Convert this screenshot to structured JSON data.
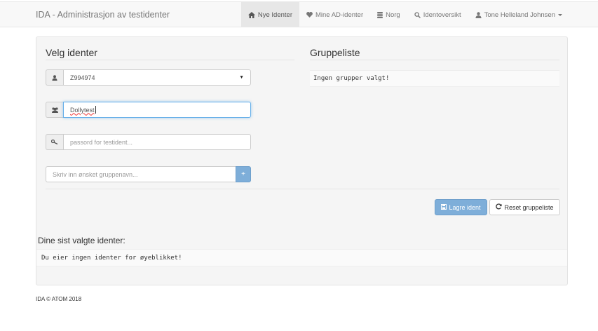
{
  "navbar": {
    "brand": "IDA - Administrasjon av testidenter",
    "items": [
      {
        "label": "Nye Identer",
        "icon": "home-icon",
        "active": true
      },
      {
        "label": "Mine AD-identer",
        "icon": "heart-icon"
      },
      {
        "label": "Norg",
        "icon": "database-icon"
      },
      {
        "label": "Identoversikt",
        "icon": "search-icon"
      },
      {
        "label": "Tone Helleland Johnsen",
        "icon": "user-icon",
        "dropdown": true
      }
    ]
  },
  "velg": {
    "title": "Velg identer",
    "user_select": {
      "value": "Z994974",
      "icon": "user-icon"
    },
    "group_field": {
      "value": "Dollytest",
      "icon": "users-icon"
    },
    "password_field": {
      "placeholder": "passord for testident...",
      "icon": "key-icon"
    },
    "group_name_field": {
      "placeholder": "Skriv inn ønsket gruppenavn...",
      "add_label": "+"
    }
  },
  "gruppeliste": {
    "title": "Gruppeliste",
    "empty_text": "Ingen grupper valgt!"
  },
  "actions": {
    "save_label": "Lagre ident",
    "reset_label": "Reset gruppeliste"
  },
  "recent": {
    "title": "Dine sist valgte identer:",
    "empty_text": "Du eier ingen identer for øyeblikket!"
  },
  "footer": {
    "text": "IDA © ATOM 2018"
  },
  "colors": {
    "primary": "#7eaed9",
    "navbar_bg": "#f8f8f8",
    "panel_bg": "#f5f5f5"
  }
}
